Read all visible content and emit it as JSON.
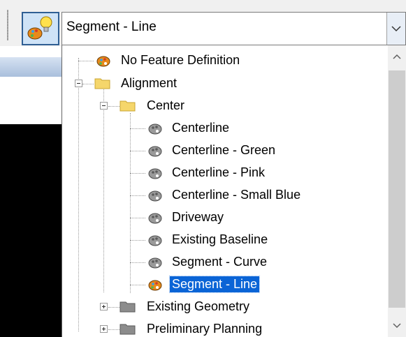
{
  "feature_button": {
    "icon": "feature-definition-icon"
  },
  "combo": {
    "selected_value": "Segment - Line"
  },
  "tree": {
    "items": [
      {
        "label": "No Feature Definition"
      },
      {
        "label": "Alignment"
      },
      {
        "label": "Center"
      },
      {
        "label": "Centerline"
      },
      {
        "label": "Centerline - Green"
      },
      {
        "label": "Centerline - Pink"
      },
      {
        "label": "Centerline - Small Blue"
      },
      {
        "label": "Driveway"
      },
      {
        "label": "Existing Baseline"
      },
      {
        "label": "Segment - Curve"
      },
      {
        "label": "Segment - Line"
      },
      {
        "label": "Existing Geometry"
      },
      {
        "label": "Preliminary Planning"
      }
    ]
  },
  "colors": {
    "selection": "#0a64d6",
    "folder_open": "#f5d66b",
    "folder_closed": "#8c8c8c",
    "active_palette": "#e88a1a"
  }
}
